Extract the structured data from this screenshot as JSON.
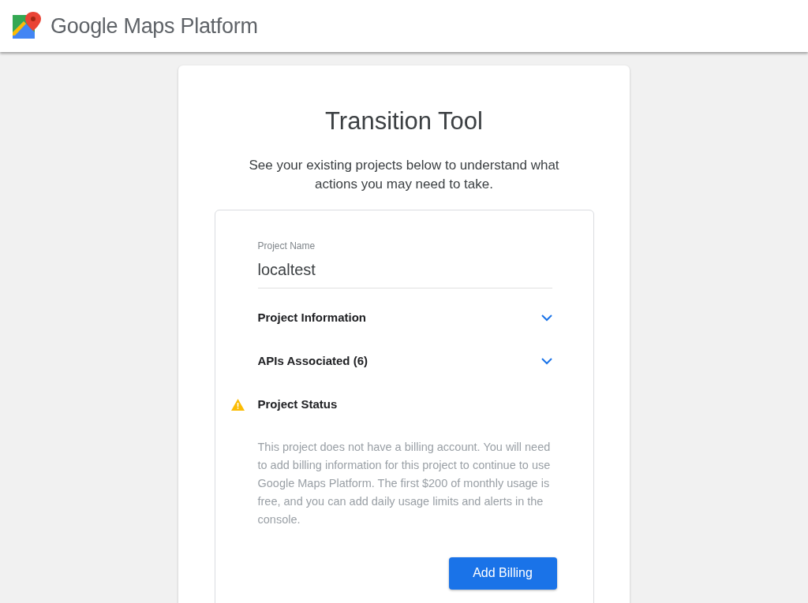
{
  "header": {
    "brand": "Google Maps Platform"
  },
  "card": {
    "title": "Transition Tool",
    "subtitle": "See your existing projects below to understand what actions you may need to take.",
    "project": {
      "label": "Project Name",
      "value": "localtest"
    },
    "sections": [
      {
        "kind": "expandable",
        "label": "Project Information",
        "expanded": false
      },
      {
        "kind": "expandable",
        "label": "APIs Associated (6)",
        "expanded": false
      },
      {
        "kind": "warning",
        "label": "Project Status"
      }
    ],
    "status_text": "This project does not have a billing account. You will need to add billing information for this project to continue to use Google Maps Platform. The first $200 of monthly usage is free, and you can add daily usage limits and alerts in the console.",
    "button": "Add Billing"
  }
}
